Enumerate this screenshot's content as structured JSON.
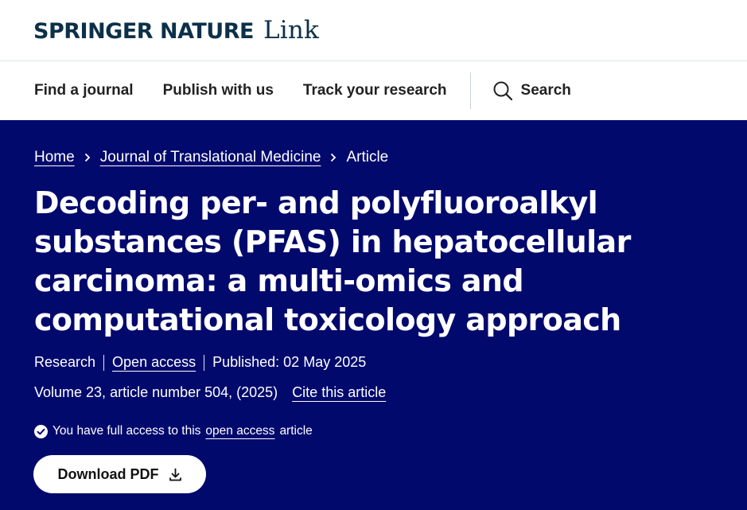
{
  "brand": {
    "springer": "Springer",
    "nature": "Nature",
    "link": "Link"
  },
  "nav": {
    "items": [
      {
        "label": "Find a journal"
      },
      {
        "label": "Publish with us"
      },
      {
        "label": "Track your research"
      }
    ],
    "search_label": "Search"
  },
  "breadcrumb": {
    "home": "Home",
    "journal": "Journal of Translational Medicine",
    "current": "Article"
  },
  "article": {
    "title": "Decoding per- and polyfluoroalkyl substances (PFAS) in hepatocellular carcinoma: a multi-omics and computational toxicology approach",
    "type": "Research",
    "access": "Open access",
    "published": "Published: 02 May 2025",
    "volume": "Volume 23, article number 504, (2025)",
    "cite": "Cite this article",
    "access_notice_prefix": "You have full access to this",
    "access_notice_link": "open access",
    "access_notice_suffix": "article",
    "download_label": "Download PDF"
  },
  "colors": {
    "hero_bg": "#01096d",
    "brand": "#0c3049"
  },
  "icons": [
    "search-icon",
    "chevron-right-icon",
    "check-circle-icon",
    "download-icon"
  ]
}
